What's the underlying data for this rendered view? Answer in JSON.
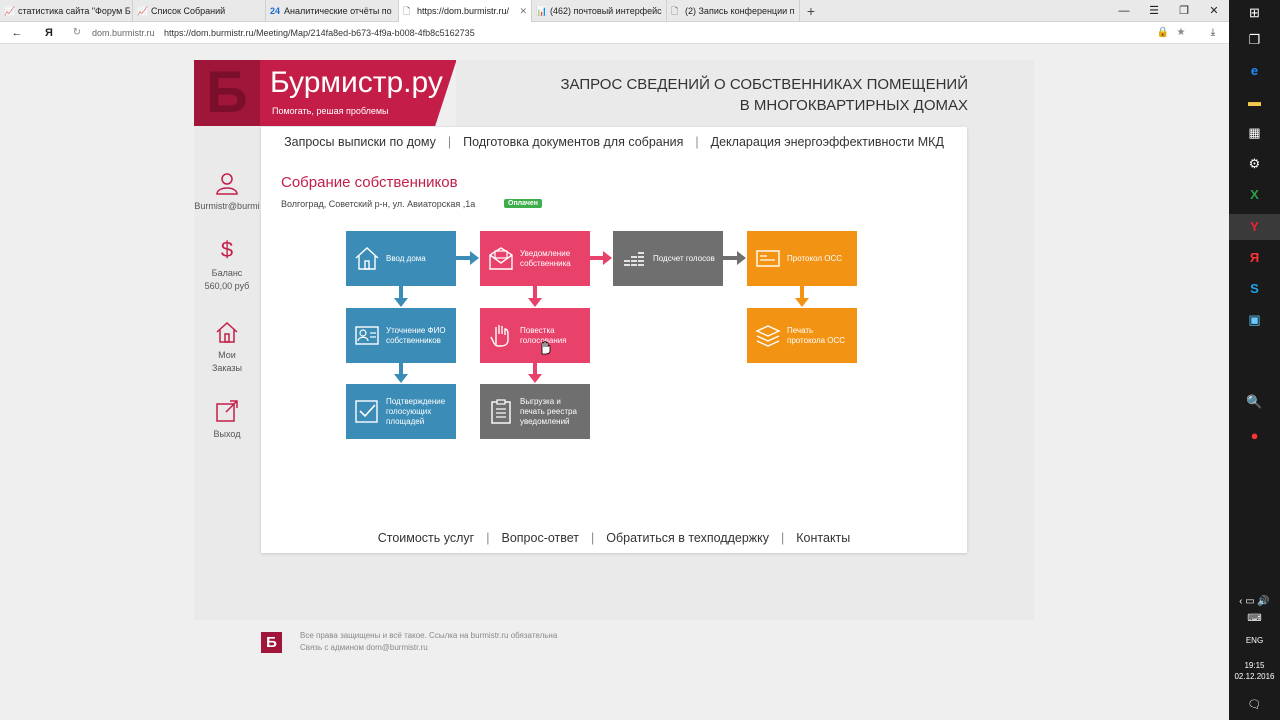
{
  "browser": {
    "tabs": [
      {
        "icon": "📈",
        "label": "статистика сайта \"Форум Б"
      },
      {
        "icon": "📈",
        "label": "Список Собраний"
      },
      {
        "icon": "24",
        "label": "Аналитические отчёты по"
      },
      {
        "icon": "🗋",
        "label": "https://dom.burmistr.ru/"
      },
      {
        "icon": "📊",
        "label": "(462) почтовый интерфейс"
      },
      {
        "icon": "🗋",
        "label": "(2) Запись конференции п"
      }
    ],
    "new_tab": "+",
    "url_domain": "dom.burmistr.ru",
    "url_full": "https://dom.burmistr.ru/Meeting/Map/214fa8ed-b673-4f9a-b008-4fb8c5162735",
    "yandex_btn": "Я"
  },
  "header": {
    "logo_letter": "Б",
    "logo_name": "Бурмистр.ру",
    "logo_slogan": "Помогать, решая проблемы",
    "title_line1": "ЗАПРОС СВЕДЕНИЙ О СОБСТВЕННИКАХ ПОМЕЩЕНИЙ",
    "title_line2": "В МНОГОКВАРТИРНЫХ ДОМАХ"
  },
  "sidebar": {
    "user": "Burmistr@burmi",
    "balance_label": "Баланс",
    "balance_value": "560,00 руб",
    "orders_line1": "Мои",
    "orders_line2": "Заказы",
    "logout": "Выход"
  },
  "topnav": [
    "Запросы выписки по дому",
    "Подготовка документов для собрания",
    "Декларация энергоэффективности МКД"
  ],
  "meeting": {
    "title": "Собрание собственников",
    "address": "Волгоград, Советский р-н, ул. Авиаторская ,1а",
    "status": "Оплачен"
  },
  "steps": {
    "house_input": "Ввод дома",
    "notify": "Уведомление собственника",
    "count": "Подсчет голосов",
    "protocol": "Протокол ОСС",
    "clarify": "Уточнение ФИО собственников",
    "agenda": "Повестка голосования",
    "print_protocol": "Печать протокола ОСС",
    "confirm": "Подтверждение голосующих площадей",
    "export": "Выгрузка и печать реестра уведомлений"
  },
  "bottomnav": [
    "Стоимость услуг",
    "Вопрос-ответ",
    "Обратиться в техподдержку",
    "Контакты"
  ],
  "footer": {
    "line1": "Все права защищены и всё такое. Ссылка на burmistr.ru обязательна",
    "line2": "Связь с админом dom@burmistr.ru"
  },
  "taskbar": {
    "lang": "ENG",
    "time": "19:15",
    "date": "02.12.2016"
  },
  "colors": {
    "brand": "#c41e48",
    "blue": "#3b8db7",
    "pink": "#e8416a",
    "gray": "#6f6f6f",
    "orange": "#f39314",
    "paid": "#3eae4c"
  }
}
